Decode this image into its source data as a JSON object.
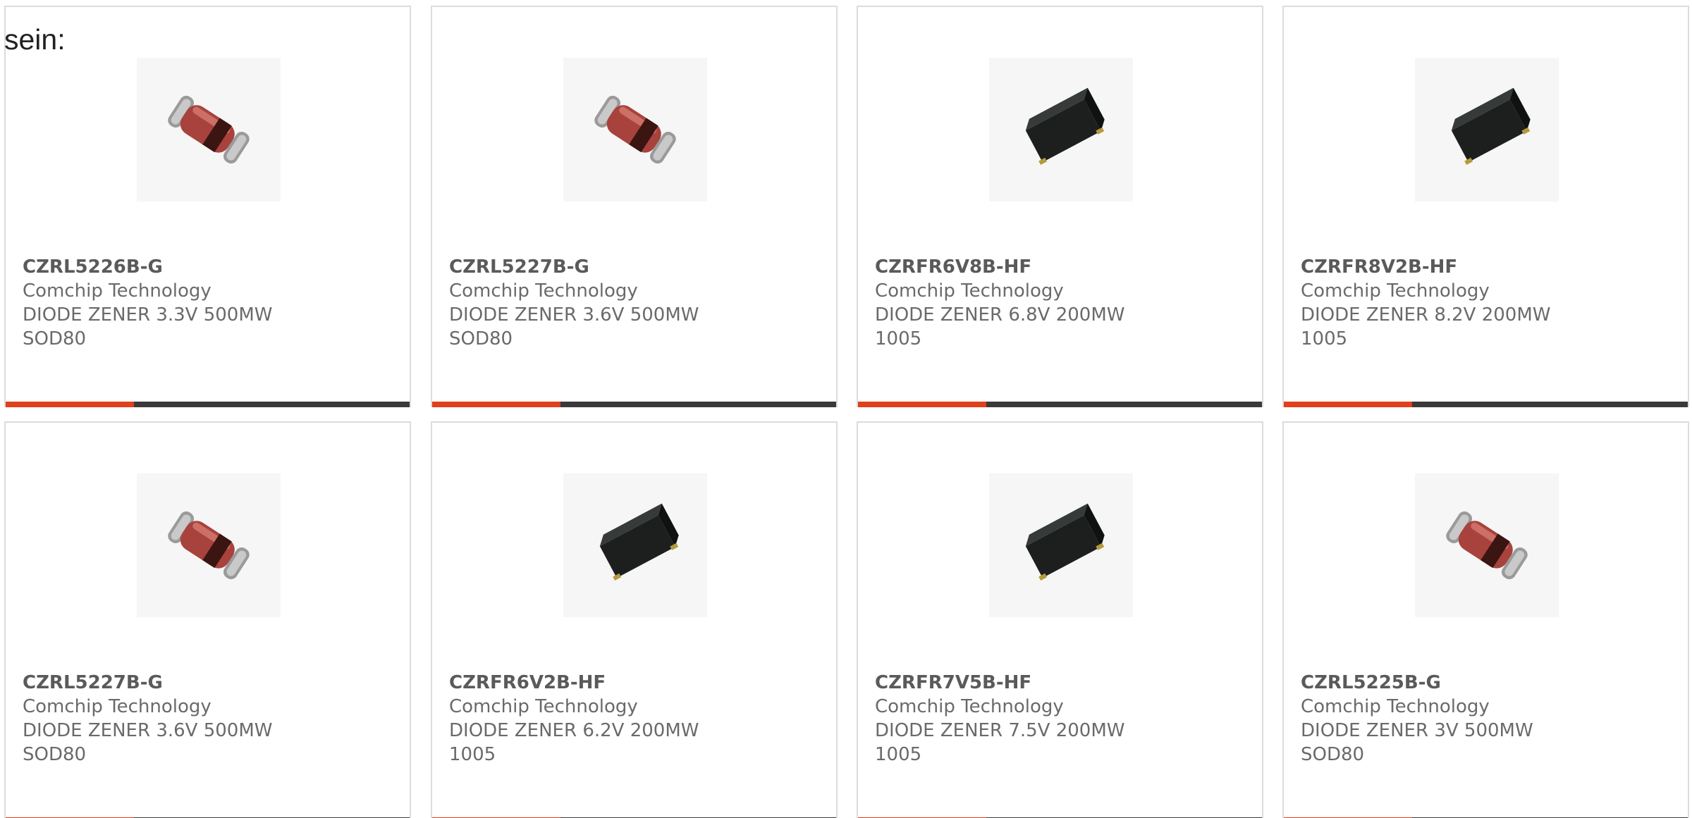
{
  "intro_text": "sein:",
  "colors": {
    "accent_bar": "#e0401c",
    "base_bar": "#3a3a3a",
    "card_border": "#dcdcdc"
  },
  "products": [
    {
      "part_number": "CZRL5226B-G",
      "manufacturer": "Comchip Technology",
      "description": "DIODE ZENER 3.3V 500MW SOD80",
      "image": "melf-glass-diode-icon"
    },
    {
      "part_number": "CZRL5227B-G",
      "manufacturer": "Comchip Technology",
      "description": "DIODE ZENER 3.6V 500MW SOD80",
      "image": "melf-glass-diode-icon"
    },
    {
      "part_number": "CZRFR6V8B-HF",
      "manufacturer": "Comchip Technology",
      "description": "DIODE ZENER 6.8V 200MW 1005",
      "image": "smd-chip-diode-icon"
    },
    {
      "part_number": "CZRFR8V2B-HF",
      "manufacturer": "Comchip Technology",
      "description": "DIODE ZENER 8.2V 200MW 1005",
      "image": "smd-chip-diode-icon"
    },
    {
      "part_number": "CZRL5227B-G",
      "manufacturer": "Comchip Technology",
      "description": "DIODE ZENER 3.6V 500MW SOD80",
      "image": "melf-glass-diode-icon"
    },
    {
      "part_number": "CZRFR6V2B-HF",
      "manufacturer": "Comchip Technology",
      "description": "DIODE ZENER 6.2V 200MW 1005",
      "image": "smd-chip-diode-icon"
    },
    {
      "part_number": "CZRFR7V5B-HF",
      "manufacturer": "Comchip Technology",
      "description": "DIODE ZENER 7.5V 200MW 1005",
      "image": "smd-chip-diode-icon"
    },
    {
      "part_number": "CZRL5225B-G",
      "manufacturer": "Comchip Technology",
      "description": "DIODE ZENER 3V 500MW SOD80",
      "image": "melf-glass-diode-icon"
    }
  ]
}
